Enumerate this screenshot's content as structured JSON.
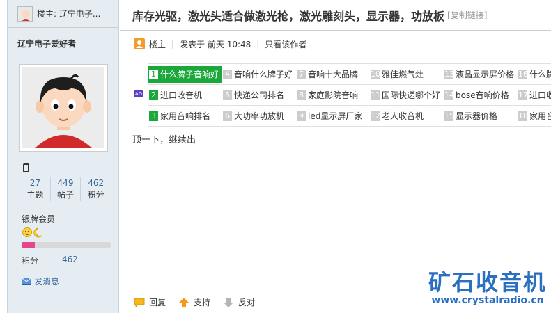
{
  "sidebar": {
    "op_label": "楼主: 辽宁电子...",
    "author_name": "辽宁电子爱好者",
    "stats": [
      {
        "num": "27",
        "label": "主题"
      },
      {
        "num": "449",
        "label": "帖子"
      },
      {
        "num": "462",
        "label": "积分"
      }
    ],
    "rank": "银牌会员",
    "progress_fraction": 0.15,
    "points_label": "积分",
    "points_value": "462",
    "send_message": "发消息"
  },
  "thread": {
    "title": "库存光驱，激光头适合做激光枪，激光雕刻头，显示器，功放板",
    "copy_link": "[复制链接]"
  },
  "post_meta": {
    "floor": "楼主",
    "posted": "发表于 前天 10:48",
    "author_only": "只看该作者"
  },
  "ads": {
    "badge": "AD",
    "rows": [
      [
        {
          "n": "1",
          "text": "什么牌子音响好"
        },
        {
          "n": "4",
          "text": "音响什么牌子好"
        },
        {
          "n": "7",
          "text": "音响十大品牌"
        },
        {
          "n": "10",
          "text": "雅佳燃气灶"
        },
        {
          "n": "13",
          "text": "液晶显示屏价格"
        },
        {
          "n": "16",
          "text": "什么牌"
        }
      ],
      [
        {
          "n": "2",
          "text": "进口收音机"
        },
        {
          "n": "5",
          "text": "快递公司排名"
        },
        {
          "n": "8",
          "text": "家庭影院音响"
        },
        {
          "n": "11",
          "text": "国际快递哪个好"
        },
        {
          "n": "14",
          "text": "bose音响价格"
        },
        {
          "n": "17",
          "text": "进口收"
        }
      ],
      [
        {
          "n": "3",
          "text": "家用音响排名"
        },
        {
          "n": "6",
          "text": "大功率功放机"
        },
        {
          "n": "9",
          "text": "led显示屏厂家"
        },
        {
          "n": "12",
          "text": "老人收音机"
        },
        {
          "n": "15",
          "text": "显示器价格"
        },
        {
          "n": "18",
          "text": "家用音"
        }
      ]
    ]
  },
  "content": "顶一下，继续出",
  "footer": {
    "reply": "回复",
    "support": "支持",
    "oppose": "反对"
  },
  "watermark": {
    "cn": "矿石收音机",
    "url": "www.crystalradio.cn"
  },
  "colors": {
    "sidebar_bg": "#e5edf2",
    "accent_green": "#1ba83b",
    "link_blue": "#336699",
    "progress_pink": "#e5478c",
    "watermark_blue": "#2b6fc1"
  }
}
